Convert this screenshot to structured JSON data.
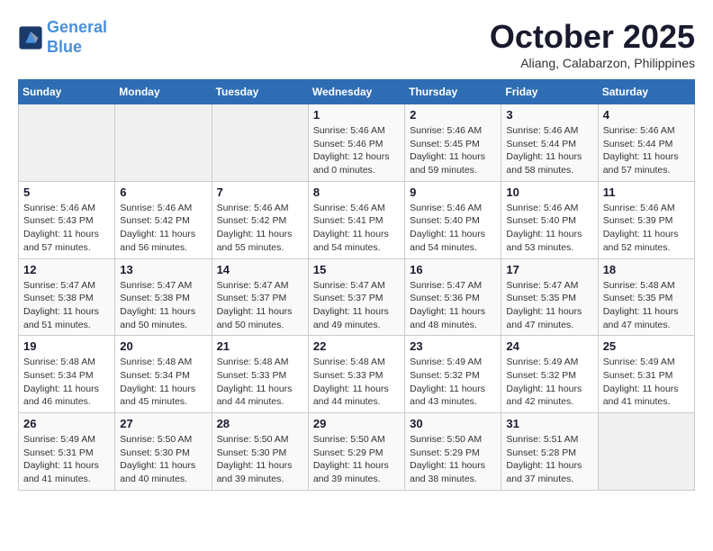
{
  "logo": {
    "line1": "General",
    "line2": "Blue"
  },
  "title": "October 2025",
  "subtitle": "Aliang, Calabarzon, Philippines",
  "weekdays": [
    "Sunday",
    "Monday",
    "Tuesday",
    "Wednesday",
    "Thursday",
    "Friday",
    "Saturday"
  ],
  "weeks": [
    [
      {
        "day": "",
        "info": ""
      },
      {
        "day": "",
        "info": ""
      },
      {
        "day": "",
        "info": ""
      },
      {
        "day": "1",
        "info": "Sunrise: 5:46 AM\nSunset: 5:46 PM\nDaylight: 12 hours\nand 0 minutes."
      },
      {
        "day": "2",
        "info": "Sunrise: 5:46 AM\nSunset: 5:45 PM\nDaylight: 11 hours\nand 59 minutes."
      },
      {
        "day": "3",
        "info": "Sunrise: 5:46 AM\nSunset: 5:44 PM\nDaylight: 11 hours\nand 58 minutes."
      },
      {
        "day": "4",
        "info": "Sunrise: 5:46 AM\nSunset: 5:44 PM\nDaylight: 11 hours\nand 57 minutes."
      }
    ],
    [
      {
        "day": "5",
        "info": "Sunrise: 5:46 AM\nSunset: 5:43 PM\nDaylight: 11 hours\nand 57 minutes."
      },
      {
        "day": "6",
        "info": "Sunrise: 5:46 AM\nSunset: 5:42 PM\nDaylight: 11 hours\nand 56 minutes."
      },
      {
        "day": "7",
        "info": "Sunrise: 5:46 AM\nSunset: 5:42 PM\nDaylight: 11 hours\nand 55 minutes."
      },
      {
        "day": "8",
        "info": "Sunrise: 5:46 AM\nSunset: 5:41 PM\nDaylight: 11 hours\nand 54 minutes."
      },
      {
        "day": "9",
        "info": "Sunrise: 5:46 AM\nSunset: 5:40 PM\nDaylight: 11 hours\nand 54 minutes."
      },
      {
        "day": "10",
        "info": "Sunrise: 5:46 AM\nSunset: 5:40 PM\nDaylight: 11 hours\nand 53 minutes."
      },
      {
        "day": "11",
        "info": "Sunrise: 5:46 AM\nSunset: 5:39 PM\nDaylight: 11 hours\nand 52 minutes."
      }
    ],
    [
      {
        "day": "12",
        "info": "Sunrise: 5:47 AM\nSunset: 5:38 PM\nDaylight: 11 hours\nand 51 minutes."
      },
      {
        "day": "13",
        "info": "Sunrise: 5:47 AM\nSunset: 5:38 PM\nDaylight: 11 hours\nand 50 minutes."
      },
      {
        "day": "14",
        "info": "Sunrise: 5:47 AM\nSunset: 5:37 PM\nDaylight: 11 hours\nand 50 minutes."
      },
      {
        "day": "15",
        "info": "Sunrise: 5:47 AM\nSunset: 5:37 PM\nDaylight: 11 hours\nand 49 minutes."
      },
      {
        "day": "16",
        "info": "Sunrise: 5:47 AM\nSunset: 5:36 PM\nDaylight: 11 hours\nand 48 minutes."
      },
      {
        "day": "17",
        "info": "Sunrise: 5:47 AM\nSunset: 5:35 PM\nDaylight: 11 hours\nand 47 minutes."
      },
      {
        "day": "18",
        "info": "Sunrise: 5:48 AM\nSunset: 5:35 PM\nDaylight: 11 hours\nand 47 minutes."
      }
    ],
    [
      {
        "day": "19",
        "info": "Sunrise: 5:48 AM\nSunset: 5:34 PM\nDaylight: 11 hours\nand 46 minutes."
      },
      {
        "day": "20",
        "info": "Sunrise: 5:48 AM\nSunset: 5:34 PM\nDaylight: 11 hours\nand 45 minutes."
      },
      {
        "day": "21",
        "info": "Sunrise: 5:48 AM\nSunset: 5:33 PM\nDaylight: 11 hours\nand 44 minutes."
      },
      {
        "day": "22",
        "info": "Sunrise: 5:48 AM\nSunset: 5:33 PM\nDaylight: 11 hours\nand 44 minutes."
      },
      {
        "day": "23",
        "info": "Sunrise: 5:49 AM\nSunset: 5:32 PM\nDaylight: 11 hours\nand 43 minutes."
      },
      {
        "day": "24",
        "info": "Sunrise: 5:49 AM\nSunset: 5:32 PM\nDaylight: 11 hours\nand 42 minutes."
      },
      {
        "day": "25",
        "info": "Sunrise: 5:49 AM\nSunset: 5:31 PM\nDaylight: 11 hours\nand 41 minutes."
      }
    ],
    [
      {
        "day": "26",
        "info": "Sunrise: 5:49 AM\nSunset: 5:31 PM\nDaylight: 11 hours\nand 41 minutes."
      },
      {
        "day": "27",
        "info": "Sunrise: 5:50 AM\nSunset: 5:30 PM\nDaylight: 11 hours\nand 40 minutes."
      },
      {
        "day": "28",
        "info": "Sunrise: 5:50 AM\nSunset: 5:30 PM\nDaylight: 11 hours\nand 39 minutes."
      },
      {
        "day": "29",
        "info": "Sunrise: 5:50 AM\nSunset: 5:29 PM\nDaylight: 11 hours\nand 39 minutes."
      },
      {
        "day": "30",
        "info": "Sunrise: 5:50 AM\nSunset: 5:29 PM\nDaylight: 11 hours\nand 38 minutes."
      },
      {
        "day": "31",
        "info": "Sunrise: 5:51 AM\nSunset: 5:28 PM\nDaylight: 11 hours\nand 37 minutes."
      },
      {
        "day": "",
        "info": ""
      }
    ]
  ]
}
